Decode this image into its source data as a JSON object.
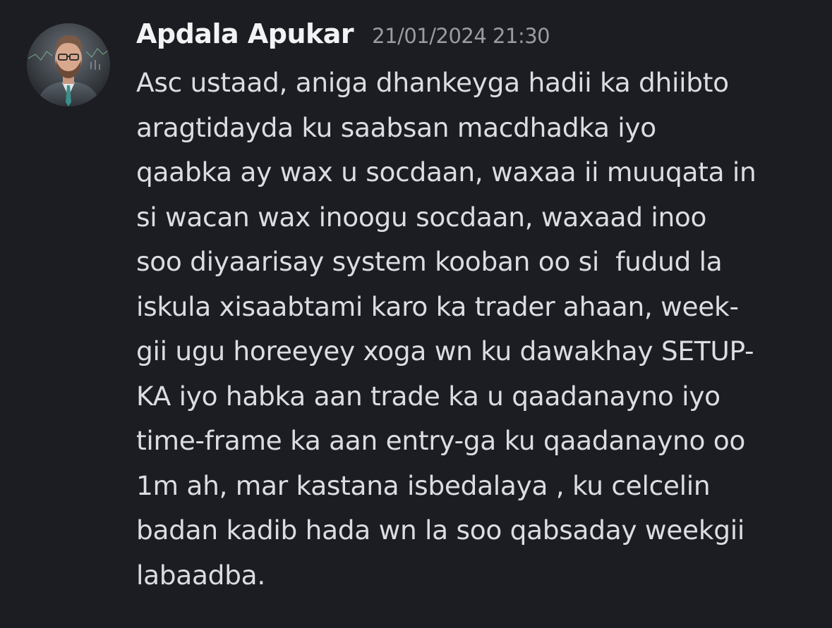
{
  "message": {
    "author": "Apdala Apukar",
    "timestamp": "21/01/2024 21:30",
    "lines": [
      "Asc ustaad, aniga dhankeyga hadii ka dhiibto",
      "aragtidayda ku saabsan macdhadka iyo",
      "qaabka ay wax u socdaan, waxaa ii muuqata in",
      "si wacan wax inoogu socdaan, waxaad inoo",
      "soo diyaarisay system kooban oo si  fudud la",
      "iskula xisaabtami karo ka trader ahaan, week-",
      "gii ugu horeeyey xoga wn ku dawakhay SETUP-",
      "KA iyo habka aan trade ka u qaadanayno iyo",
      "time-frame ka aan entry-ga ku qaadanayno oo",
      "1m ah, mar kastana isbedalaya , ku celcelin",
      "badan kadib hada wn la soo qabsaday weekgii",
      "labaadba."
    ]
  },
  "avatar": {
    "icon": "user-avatar-photo"
  },
  "colors": {
    "background": "#1c1d22",
    "username": "#f2f3f5",
    "timestamp": "#9a9ca3",
    "text": "#dbdde1"
  }
}
